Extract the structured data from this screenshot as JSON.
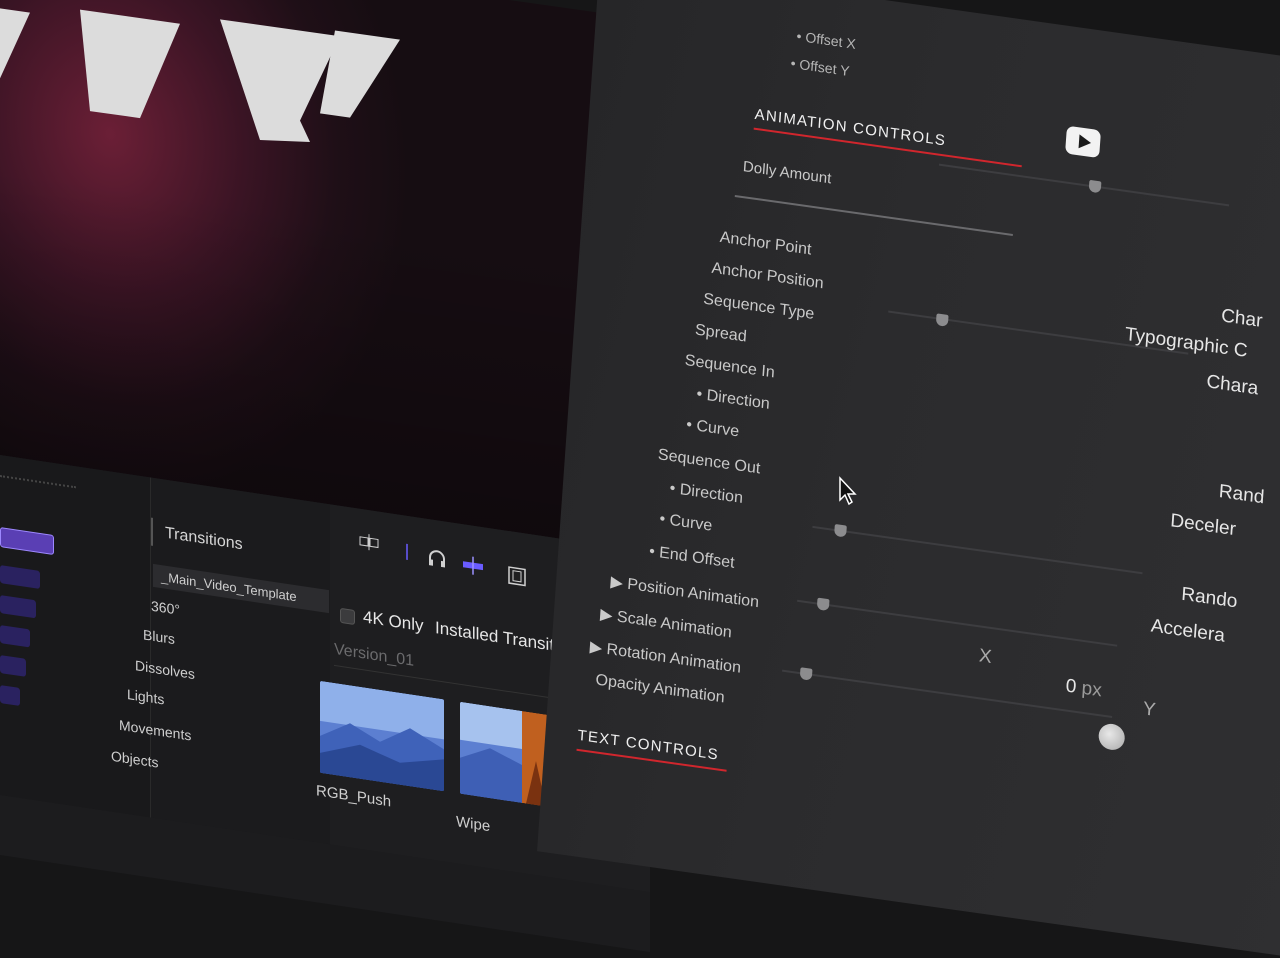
{
  "viewer": {
    "title_letters": "VY"
  },
  "browser": {
    "header": "Transitions",
    "categories": [
      "_Main_Video_Template",
      "360°",
      "Blurs",
      "Dissolves",
      "Lights",
      "Movements",
      "Objects"
    ],
    "filter_checkbox_label": "4K Only",
    "source_select": "Installed Transitions",
    "group_label": "Version_01",
    "thumbnails": [
      {
        "label": "RGB_Push"
      },
      {
        "label": "Wipe"
      }
    ],
    "icons": [
      "clip-appearance-icon",
      "skimming-icon",
      "audio-skimming-icon",
      "snapping-icon",
      "filmstrip-icon",
      "window-icon",
      "transitions-browser-icon",
      "fullscreen-icon"
    ]
  },
  "inspector": {
    "offset_x": "• Offset X",
    "offset_y": "• Offset Y",
    "animation_controls": "ANIMATION CONTROLS",
    "dolly_amount": "Dolly Amount",
    "anchor_point": "Anchor Point",
    "anchor_position": "Anchor Position",
    "sequence_type": "Sequence Type",
    "spread": "Spread",
    "sequence_in": "Sequence In",
    "direction_in": "• Direction",
    "curve_in": "• Curve",
    "sequence_out": "Sequence Out",
    "direction_out": "• Direction",
    "curve_out": "• Curve",
    "end_offset": "• End Offset",
    "position_animation": "Position Animation",
    "scale_animation": "Scale Animation",
    "rotation_animation": "Rotation Animation",
    "opacity_animation": "Opacity Animation",
    "text_controls": "TEXT CONTROLS",
    "values": {
      "anchor_point": "Char",
      "anchor_position": "Typographic C",
      "sequence_type": "Chara",
      "direction_in": "Rand",
      "curve_in": "Deceler",
      "direction_out": "Rando",
      "curve_out": "Accelera",
      "x_label": "X",
      "x_value": "0",
      "x_unit": "px",
      "y_label": "Y"
    },
    "colors": {
      "accent_red": "#d1262d",
      "accent_purple": "#6a5cff"
    }
  }
}
